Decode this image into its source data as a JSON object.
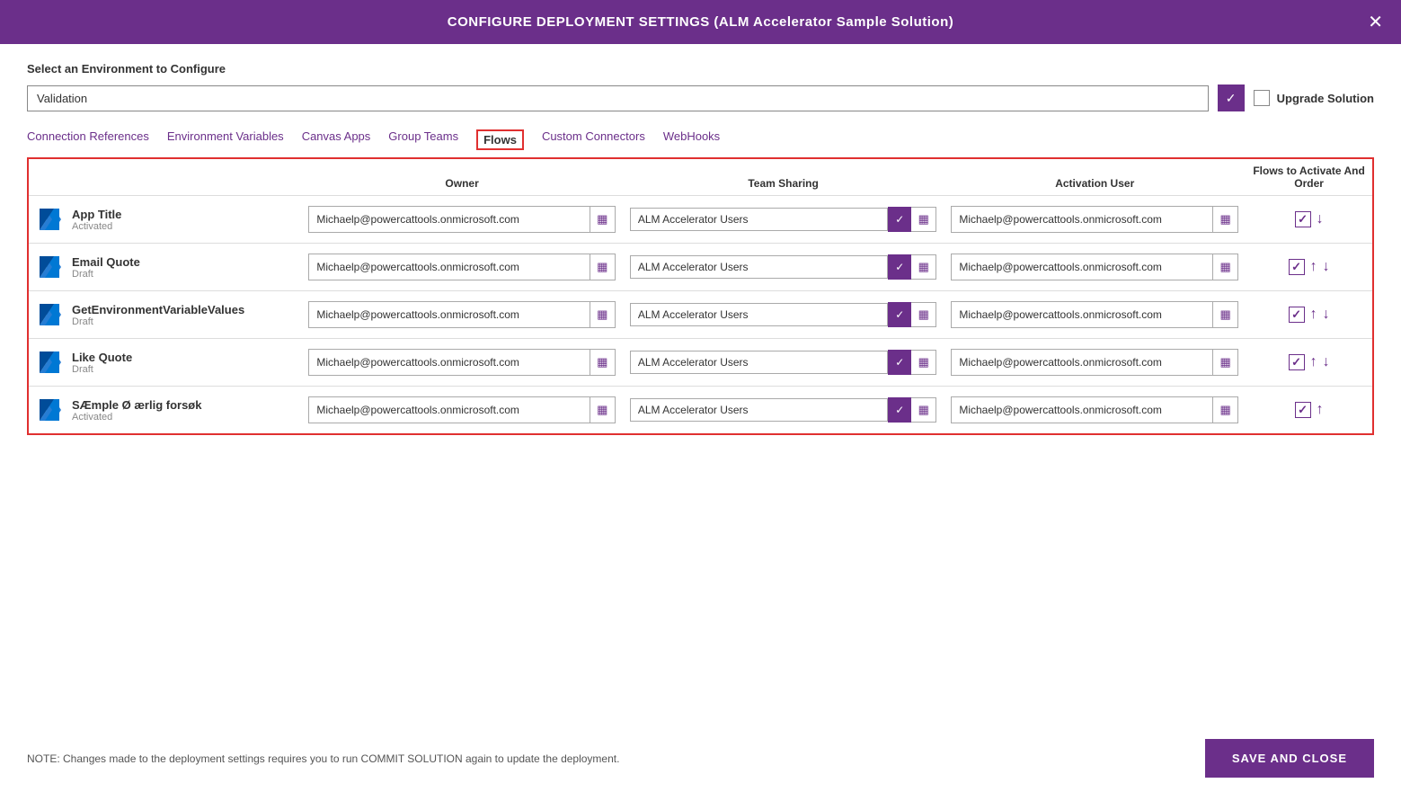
{
  "header": {
    "title": "CONFIGURE DEPLOYMENT SETTINGS (ALM Accelerator Sample Solution)",
    "close_label": "✕"
  },
  "env_section": {
    "label": "Select an Environment to Configure",
    "selected_env": "Validation",
    "upgrade_label": "Upgrade Solution"
  },
  "tabs": [
    {
      "id": "connection-refs",
      "label": "Connection References",
      "active": false
    },
    {
      "id": "env-vars",
      "label": "Environment Variables",
      "active": false
    },
    {
      "id": "canvas-apps",
      "label": "Canvas Apps",
      "active": false
    },
    {
      "id": "group-teams",
      "label": "Group Teams",
      "active": false
    },
    {
      "id": "flows",
      "label": "Flows",
      "active": true
    },
    {
      "id": "custom-connectors",
      "label": "Custom Connectors",
      "active": false
    },
    {
      "id": "webhooks",
      "label": "WebHooks",
      "active": false
    }
  ],
  "table": {
    "headers": {
      "name": "",
      "owner": "Owner",
      "team_sharing": "Team Sharing",
      "activation_user": "Activation User",
      "flows_activate": "Flows to Activate And Order"
    },
    "rows": [
      {
        "name": "App Title",
        "status": "Activated",
        "owner": "Michaelp@powercattools.onmicrosoft.com",
        "team": "ALM Accelerator Users",
        "activation_user": "Michaelp@powercattools.onmicrosoft.com",
        "checked": true,
        "up": false,
        "down": true
      },
      {
        "name": "Email Quote",
        "status": "Draft",
        "owner": "Michaelp@powercattools.onmicrosoft.com",
        "team": "ALM Accelerator Users",
        "activation_user": "Michaelp@powercattools.onmicrosoft.com",
        "checked": true,
        "up": true,
        "down": true
      },
      {
        "name": "GetEnvironmentVariableValues",
        "status": "Draft",
        "owner": "Michaelp@powercattools.onmicrosoft.com",
        "team": "ALM Accelerator Users",
        "activation_user": "Michaelp@powercattools.onmicrosoft.com",
        "checked": true,
        "up": true,
        "down": true
      },
      {
        "name": "Like Quote",
        "status": "Draft",
        "owner": "Michaelp@powercattools.onmicrosoft.com",
        "team": "ALM Accelerator Users",
        "activation_user": "Michaelp@powercattools.onmicrosoft.com",
        "checked": true,
        "up": true,
        "down": true
      },
      {
        "name": "SÆmple Ø ærlig forsøk",
        "status": "Activated",
        "owner": "Michaelp@powercattools.onmicrosoft.com",
        "team": "ALM Accelerator Users",
        "activation_user": "Michaelp@powercattools.onmicrosoft.com",
        "checked": true,
        "up": true,
        "down": false
      }
    ]
  },
  "footer": {
    "note": "NOTE: Changes made to the deployment settings requires you to run COMMIT SOLUTION again to update the deployment.",
    "save_close": "SAVE AND CLOSE"
  }
}
